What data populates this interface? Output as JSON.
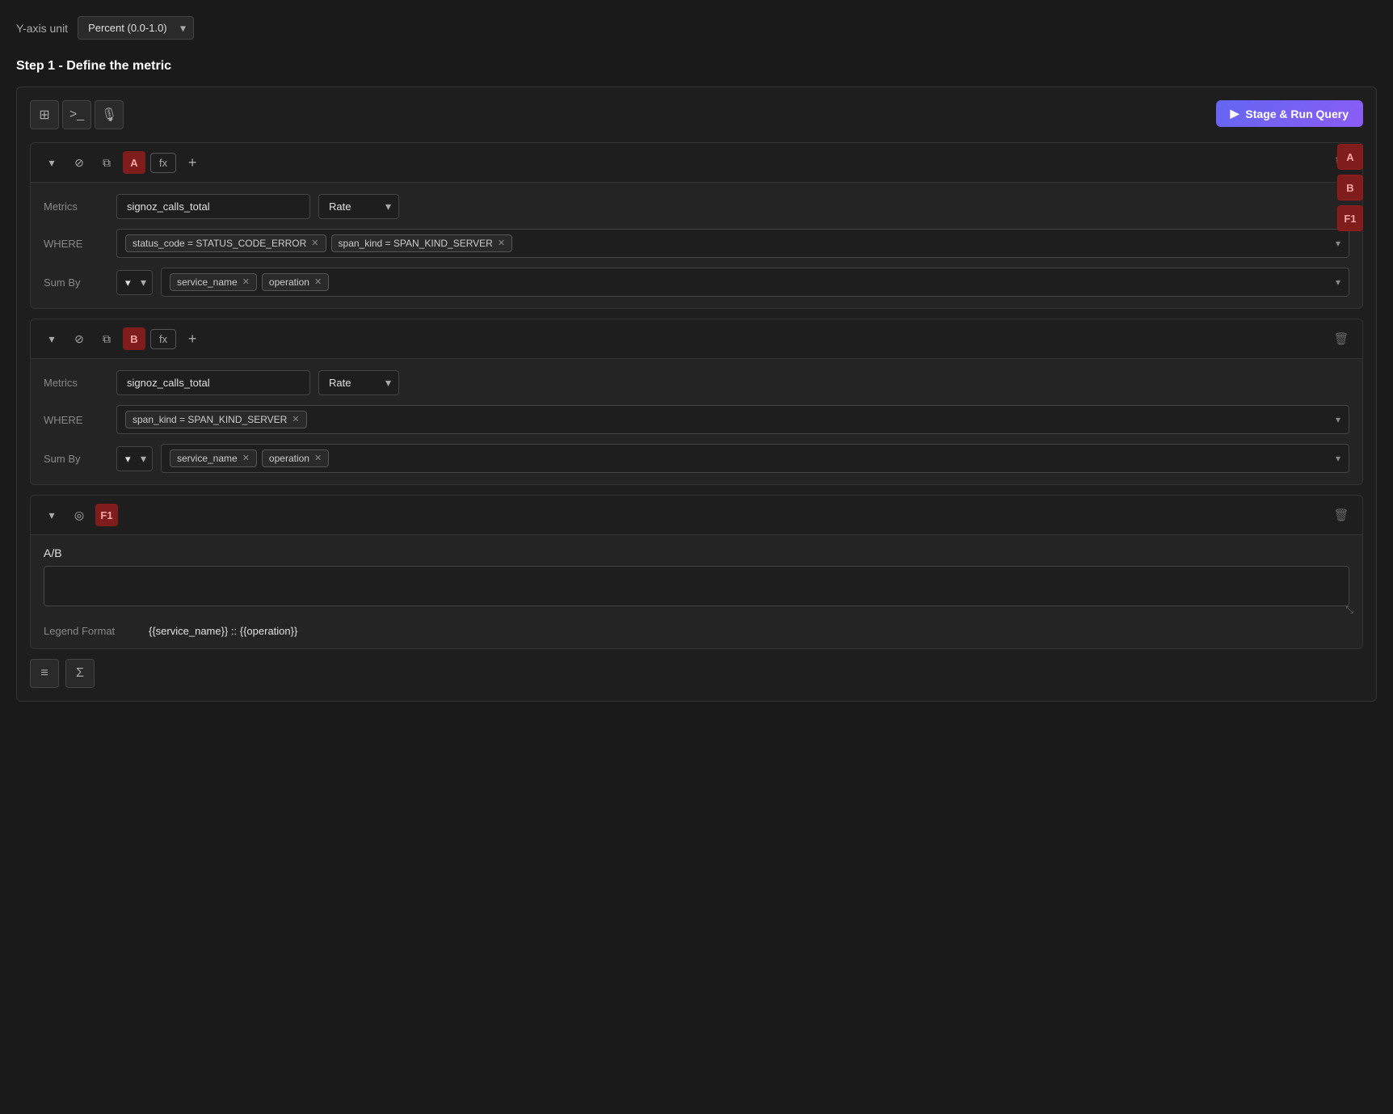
{
  "yaxis": {
    "label": "Y-axis unit",
    "option": "Percent (0.0-1.0)"
  },
  "step_title": "Step 1 - Define the metric",
  "toolbar": {
    "stage_run_label": "Stage & Run Query"
  },
  "side_labels": {
    "a": "A",
    "b": "B",
    "f1": "F1"
  },
  "query_a": {
    "label": "A",
    "metrics_label": "Metrics",
    "metrics_value": "signoz_calls_total",
    "rate_value": "Rate",
    "where_label": "WHERE",
    "where_tags": [
      {
        "text": "status_code = STATUS_CODE_ERROR"
      },
      {
        "text": "span_kind = SPAN_KIND_SERVER"
      }
    ],
    "sum_by_label": "Sum By",
    "sum_by_tags": [
      {
        "text": "service_name"
      },
      {
        "text": "operation"
      }
    ]
  },
  "query_b": {
    "label": "B",
    "metrics_label": "Metrics",
    "metrics_value": "signoz_calls_total",
    "rate_value": "Rate",
    "where_label": "WHERE",
    "where_tags": [
      {
        "text": "span_kind = SPAN_KIND_SERVER"
      }
    ],
    "sum_by_label": "Sum By",
    "sum_by_tags": [
      {
        "text": "service_name"
      },
      {
        "text": "operation"
      }
    ]
  },
  "formula_f1": {
    "label": "F1",
    "formula_text": "A/B",
    "legend_label": "Legend Format",
    "legend_value": "{{service_name}} :: {{operation}}"
  },
  "bottom_toolbar": {
    "add_query_title": "Add Query",
    "sigma_title": "Add Formula"
  }
}
